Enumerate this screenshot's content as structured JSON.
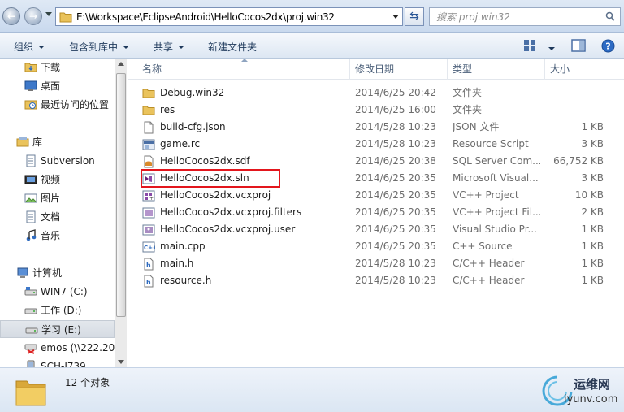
{
  "address_bar": {
    "path": "E:\\Workspace\\EclipseAndroid\\HelloCocos2dx\\proj.win32",
    "search_placeholder": "搜索 proj.win32"
  },
  "toolbar": {
    "organize": "组织",
    "include_in_library": "包含到库中",
    "share": "共享",
    "new_folder": "新建文件夹"
  },
  "nav": {
    "items": [
      {
        "label": "下载",
        "icon": "download-folder-icon"
      },
      {
        "label": "桌面",
        "icon": "desktop-icon"
      },
      {
        "label": "最近访问的位置",
        "icon": "recent-places-icon"
      },
      {
        "label": "库",
        "icon": "library-icon"
      },
      {
        "label": "Subversion",
        "icon": "subversion-library-icon"
      },
      {
        "label": "视频",
        "icon": "videos-icon"
      },
      {
        "label": "图片",
        "icon": "pictures-icon"
      },
      {
        "label": "文档",
        "icon": "documents-icon"
      },
      {
        "label": "音乐",
        "icon": "music-icon"
      },
      {
        "label": "计算机",
        "icon": "computer-icon"
      },
      {
        "label": "WIN7 (C:)",
        "icon": "system-drive-icon"
      },
      {
        "label": "工作 (D:)",
        "icon": "drive-icon"
      },
      {
        "label": "学习 (E:)",
        "icon": "drive-icon"
      },
      {
        "label": "emos (\\\\222.20",
        "icon": "network-drive-icon"
      },
      {
        "label": "SCH-I739",
        "icon": "phone-icon"
      }
    ]
  },
  "columns": {
    "name": "名称",
    "date": "修改日期",
    "type": "类型",
    "size": "大小"
  },
  "files": [
    {
      "name": "Debug.win32",
      "date": "2014/6/25 20:42",
      "type": "文件夹",
      "size": "",
      "icon": "folder-icon"
    },
    {
      "name": "res",
      "date": "2014/6/25 16:00",
      "type": "文件夹",
      "size": "",
      "icon": "folder-icon"
    },
    {
      "name": "build-cfg.json",
      "date": "2014/5/28 10:23",
      "type": "JSON 文件",
      "size": "1 KB",
      "icon": "blank-file-icon"
    },
    {
      "name": "game.rc",
      "date": "2014/5/28 10:23",
      "type": "Resource Script",
      "size": "3 KB",
      "icon": "resource-script-icon"
    },
    {
      "name": "HelloCocos2dx.sdf",
      "date": "2014/6/25 20:38",
      "type": "SQL Server Com...",
      "size": "66,752 KB",
      "icon": "sql-file-icon"
    },
    {
      "name": "HelloCocos2dx.sln",
      "date": "2014/6/25 20:35",
      "type": "Microsoft Visual...",
      "size": "3 KB",
      "icon": "vs-solution-icon"
    },
    {
      "name": "HelloCocos2dx.vcxproj",
      "date": "2014/6/25 20:35",
      "type": "VC++ Project",
      "size": "10 KB",
      "icon": "vcxproj-icon"
    },
    {
      "name": "HelloCocos2dx.vcxproj.filters",
      "date": "2014/6/25 20:35",
      "type": "VC++ Project Fil...",
      "size": "2 KB",
      "icon": "filters-file-icon"
    },
    {
      "name": "HelloCocos2dx.vcxproj.user",
      "date": "2014/6/25 20:35",
      "type": "Visual Studio Pr...",
      "size": "1 KB",
      "icon": "user-file-icon"
    },
    {
      "name": "main.cpp",
      "date": "2014/6/25 20:35",
      "type": "C++ Source",
      "size": "1 KB",
      "icon": "cpp-file-icon"
    },
    {
      "name": "main.h",
      "date": "2014/5/28 10:23",
      "type": "C/C++ Header",
      "size": "1 KB",
      "icon": "header-file-icon"
    },
    {
      "name": "resource.h",
      "date": "2014/5/28 10:23",
      "type": "C/C++ Header",
      "size": "1 KB",
      "icon": "header-file-icon"
    }
  ],
  "status": {
    "count": "12 个对象"
  },
  "watermark": {
    "cn": "运维网",
    "en": "iyunv.com"
  },
  "colors": {
    "highlight": "#e3161d",
    "accent": "#1e395b"
  }
}
